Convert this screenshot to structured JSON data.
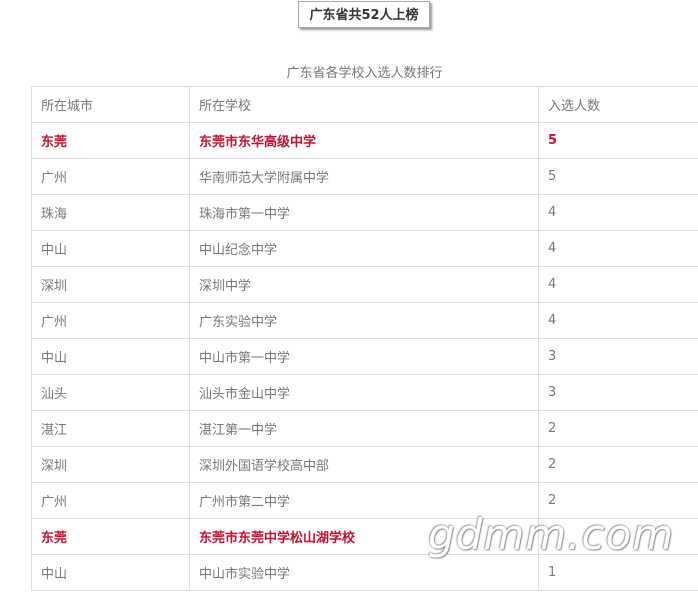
{
  "header": {
    "title": "广东省共52人上榜"
  },
  "table": {
    "caption": "广东省各学校入选人数排行",
    "columns": [
      "所在城市",
      "所在学校",
      "入选人数"
    ],
    "highlight_color": "#c8102e",
    "rows": [
      {
        "city": "东莞",
        "school": "东莞市东华高级中学",
        "count": "5",
        "highlight": true
      },
      {
        "city": "广州",
        "school": "华南师范大学附属中学",
        "count": "5",
        "highlight": false
      },
      {
        "city": "珠海",
        "school": "珠海市第一中学",
        "count": "4",
        "highlight": false
      },
      {
        "city": "中山",
        "school": "中山纪念中学",
        "count": "4",
        "highlight": false
      },
      {
        "city": "深圳",
        "school": "深圳中学",
        "count": "4",
        "highlight": false
      },
      {
        "city": "广州",
        "school": "广东实验中学",
        "count": "4",
        "highlight": false
      },
      {
        "city": "中山",
        "school": "中山市第一中学",
        "count": "3",
        "highlight": false
      },
      {
        "city": "汕头",
        "school": "汕头市金山中学",
        "count": "3",
        "highlight": false
      },
      {
        "city": "湛江",
        "school": "湛江第一中学",
        "count": "2",
        "highlight": false
      },
      {
        "city": "深圳",
        "school": "深圳外国语学校高中部",
        "count": "2",
        "highlight": false
      },
      {
        "city": "广州",
        "school": "广州市第二中学",
        "count": "2",
        "highlight": false
      },
      {
        "city": "东莞",
        "school": "东莞市东莞中学松山湖学校",
        "count": "",
        "highlight": true
      },
      {
        "city": "中山",
        "school": "中山市实验中学",
        "count": "1",
        "highlight": false
      }
    ]
  },
  "watermark": {
    "text": "gdmm.com"
  }
}
